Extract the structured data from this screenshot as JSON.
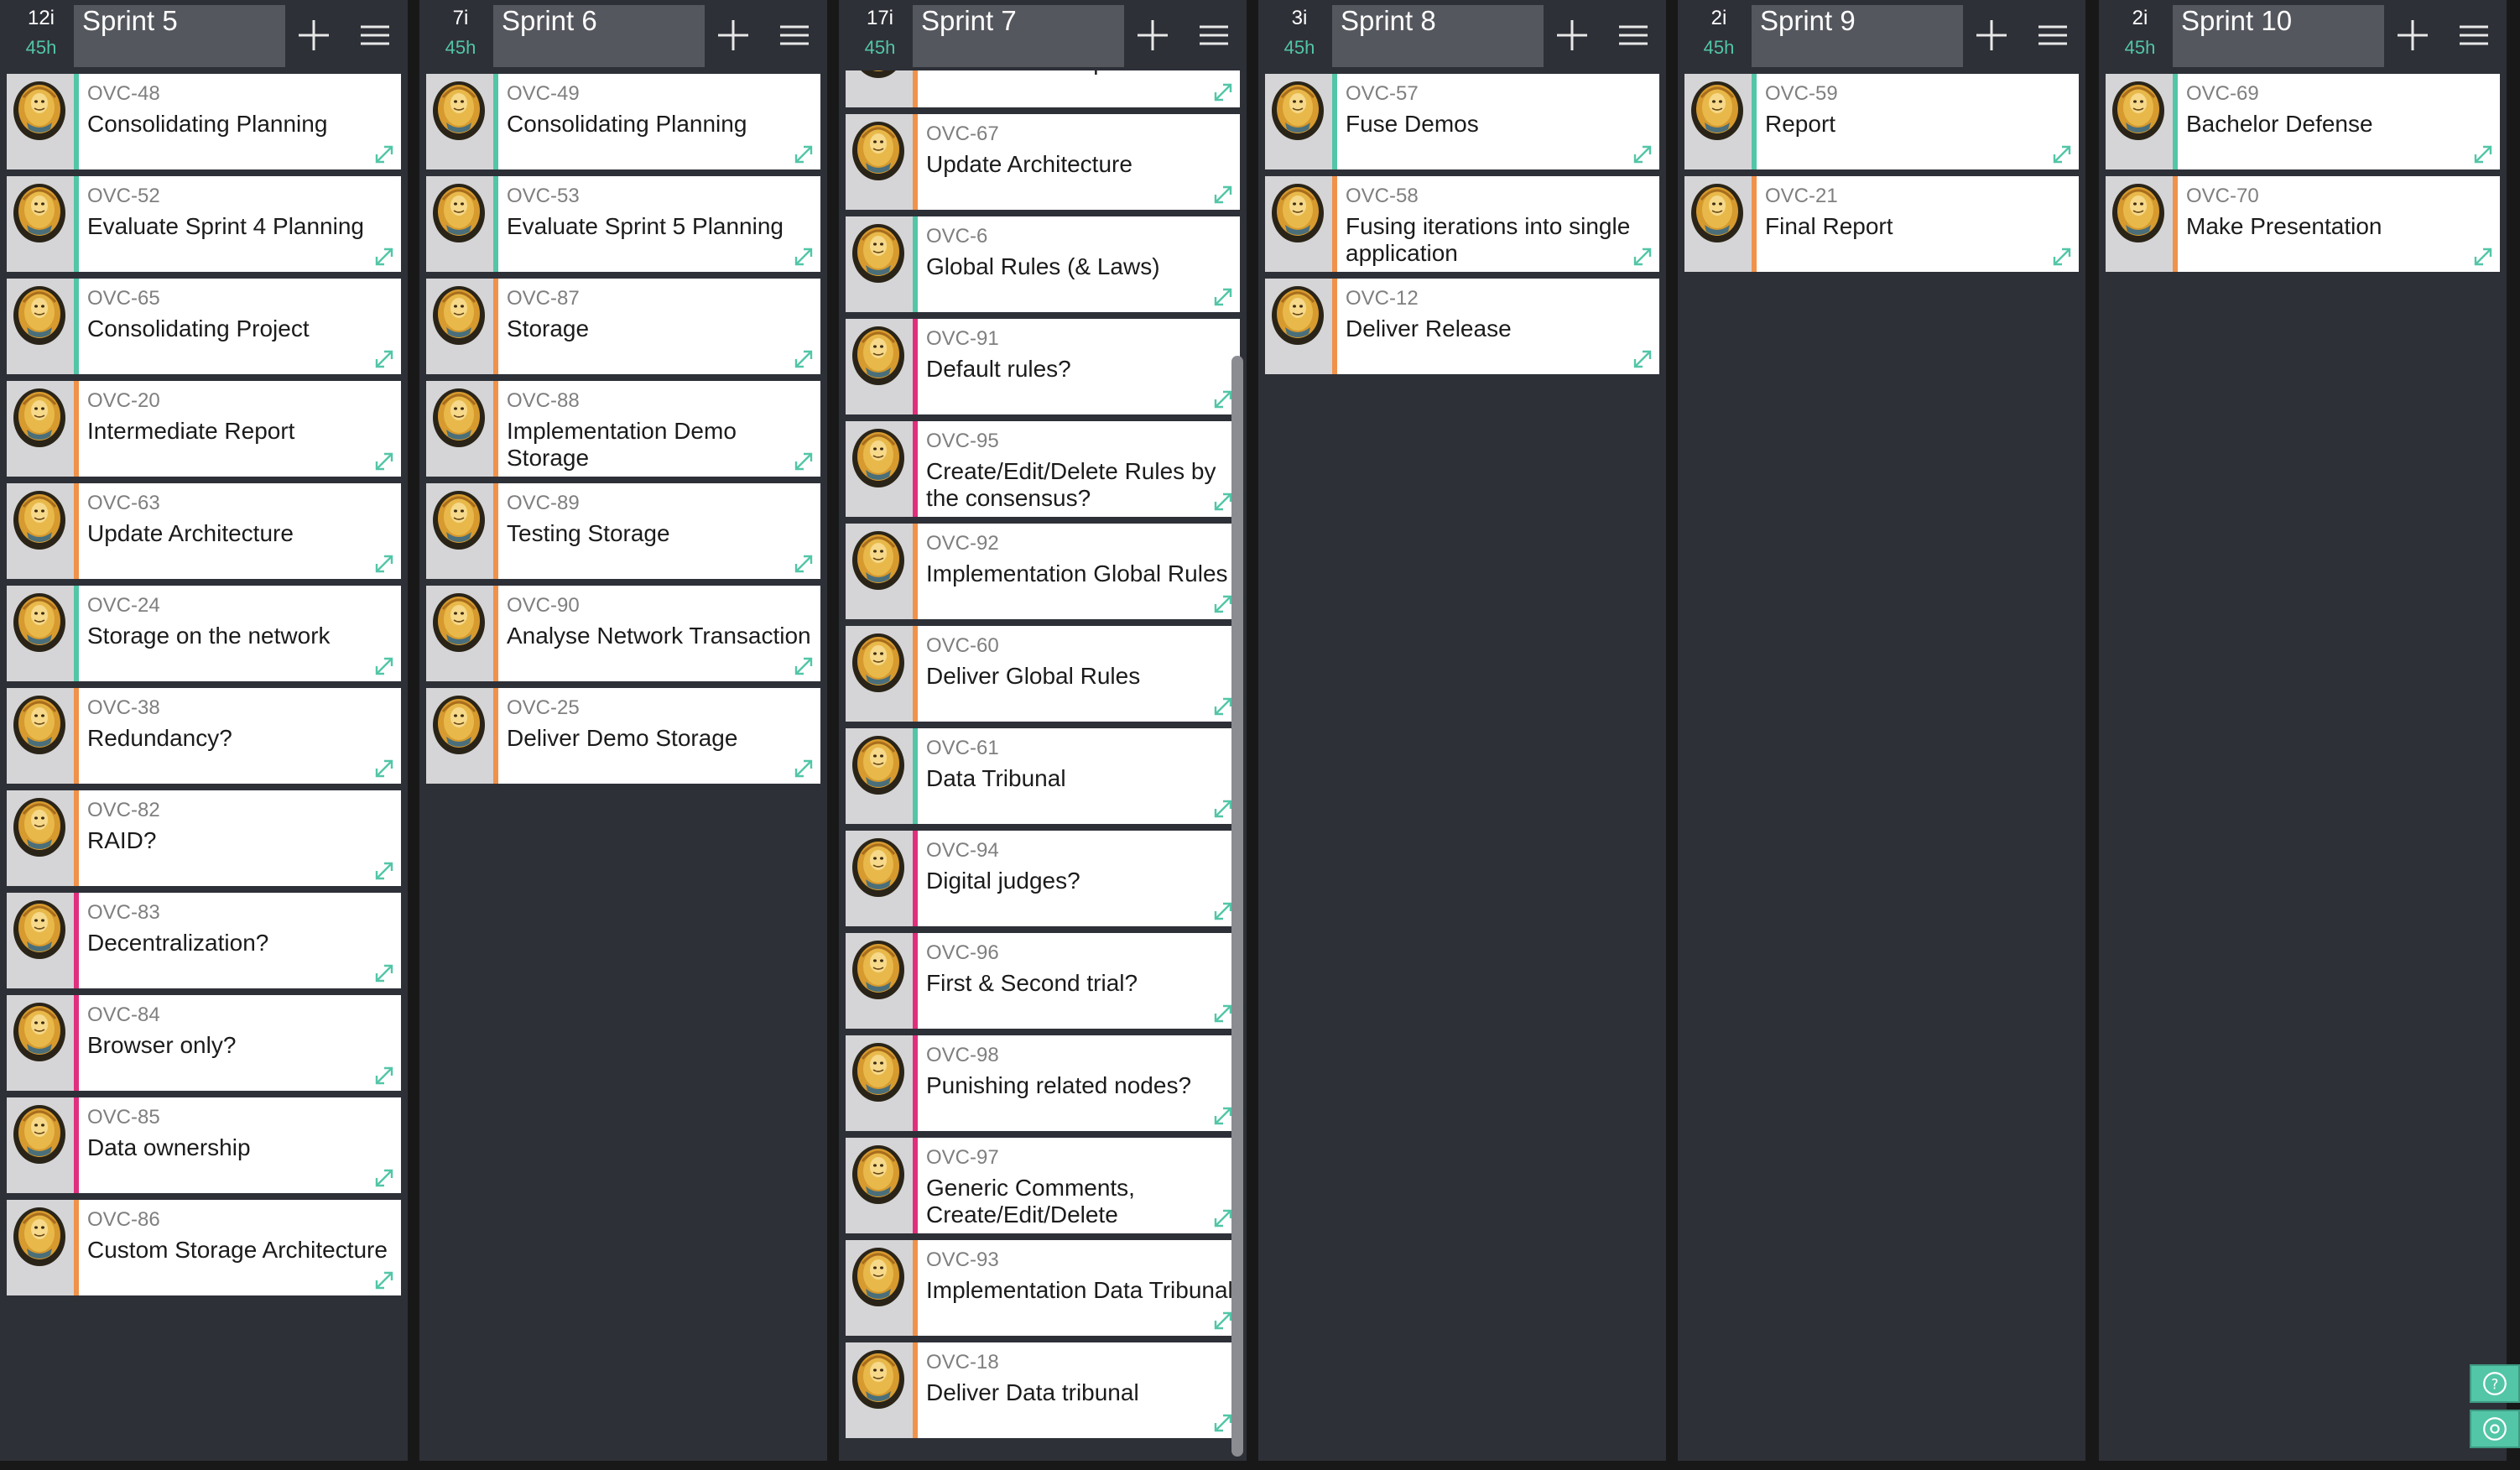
{
  "colors": {
    "background": "#181818",
    "column": "#2e3038",
    "title_box": "#55575e",
    "accent_teal": "#52c6a7",
    "stripe_teal": "#52c6a7",
    "stripe_orange": "#f0924a",
    "stripe_pink": "#e02f7d"
  },
  "columns": [
    {
      "count": "12i",
      "hours": "45h",
      "title": "Sprint 5",
      "cards": [
        {
          "key": "OVC-48",
          "title": "Consolidating Planning",
          "stripe": "teal"
        },
        {
          "key": "OVC-52",
          "title": "Evaluate Sprint 4 Planning",
          "stripe": "teal"
        },
        {
          "key": "OVC-65",
          "title": "Consolidating Project",
          "stripe": "teal"
        },
        {
          "key": "OVC-20",
          "title": "Intermediate Report",
          "stripe": "orange"
        },
        {
          "key": "OVC-63",
          "title": "Update Architecture",
          "stripe": "orange"
        },
        {
          "key": "OVC-24",
          "title": "Storage on the network",
          "stripe": "teal"
        },
        {
          "key": "OVC-38",
          "title": "Redundancy?",
          "stripe": "orange"
        },
        {
          "key": "OVC-82",
          "title": "RAID?",
          "stripe": "orange"
        },
        {
          "key": "OVC-83",
          "title": "Decentralization?",
          "stripe": "pink"
        },
        {
          "key": "OVC-84",
          "title": "Browser only?",
          "stripe": "pink"
        },
        {
          "key": "OVC-85",
          "title": "Data ownership",
          "stripe": "pink"
        },
        {
          "key": "OVC-86",
          "title": "Custom Storage Architecture",
          "stripe": "orange"
        }
      ]
    },
    {
      "count": "7i",
      "hours": "45h",
      "title": "Sprint 6",
      "cards": [
        {
          "key": "OVC-49",
          "title": "Consolidating Planning",
          "stripe": "teal"
        },
        {
          "key": "OVC-53",
          "title": "Evaluate Sprint 5 Planning",
          "stripe": "teal"
        },
        {
          "key": "OVC-87",
          "title": "Storage",
          "stripe": "orange"
        },
        {
          "key": "OVC-88",
          "title": "Implementation Demo Storage",
          "stripe": "orange"
        },
        {
          "key": "OVC-89",
          "title": "Testing Storage",
          "stripe": "orange"
        },
        {
          "key": "OVC-90",
          "title": "Analyse Network Transaction",
          "stripe": "orange"
        },
        {
          "key": "OVC-25",
          "title": "Deliver Demo Storage",
          "stripe": "orange"
        }
      ]
    },
    {
      "count": "17i",
      "hours": "45h",
      "title": "Sprint 7",
      "cards": [
        {
          "key": "",
          "title": "Intermediate Report",
          "stripe": "orange"
        },
        {
          "key": "OVC-67",
          "title": "Update Architecture",
          "stripe": "orange"
        },
        {
          "key": "OVC-6",
          "title": "Global Rules (& Laws)",
          "stripe": "teal"
        },
        {
          "key": "OVC-91",
          "title": "Default rules?",
          "stripe": "pink"
        },
        {
          "key": "OVC-95",
          "title": "Create/Edit/Delete Rules by the consensus?",
          "stripe": "pink"
        },
        {
          "key": "OVC-92",
          "title": "Implementation Global Rules",
          "stripe": "orange"
        },
        {
          "key": "OVC-60",
          "title": "Deliver Global Rules",
          "stripe": "orange"
        },
        {
          "key": "OVC-61",
          "title": "Data Tribunal",
          "stripe": "teal"
        },
        {
          "key": "OVC-94",
          "title": "Digital judges?",
          "stripe": "pink"
        },
        {
          "key": "OVC-96",
          "title": "First & Second trial?",
          "stripe": "pink"
        },
        {
          "key": "OVC-98",
          "title": "Punishing related nodes?",
          "stripe": "pink"
        },
        {
          "key": "OVC-97",
          "title": "Generic Comments, Create/Edit/Delete",
          "stripe": "pink"
        },
        {
          "key": "OVC-93",
          "title": "Implementation Data Tribunal",
          "stripe": "orange"
        },
        {
          "key": "OVC-18",
          "title": "Deliver Data tribunal",
          "stripe": "orange"
        }
      ]
    },
    {
      "count": "3i",
      "hours": "45h",
      "title": "Sprint 8",
      "cards": [
        {
          "key": "OVC-57",
          "title": "Fuse Demos",
          "stripe": "teal"
        },
        {
          "key": "OVC-58",
          "title": "Fusing iterations into single application",
          "stripe": "orange"
        },
        {
          "key": "OVC-12",
          "title": "Deliver Release",
          "stripe": "orange"
        }
      ]
    },
    {
      "count": "2i",
      "hours": "45h",
      "title": "Sprint 9",
      "cards": [
        {
          "key": "OVC-59",
          "title": "Report",
          "stripe": "teal"
        },
        {
          "key": "OVC-21",
          "title": "Final Report",
          "stripe": "orange"
        }
      ]
    },
    {
      "count": "2i",
      "hours": "45h",
      "title": "Sprint 10",
      "cards": [
        {
          "key": "OVC-69",
          "title": "Bachelor Defense",
          "stripe": "teal"
        },
        {
          "key": "OVC-70",
          "title": "Make Presentation",
          "stripe": "orange"
        }
      ]
    }
  ],
  "floating_buttons": [
    {
      "icon": "question-mark-icon"
    },
    {
      "icon": "settings-icon"
    }
  ]
}
